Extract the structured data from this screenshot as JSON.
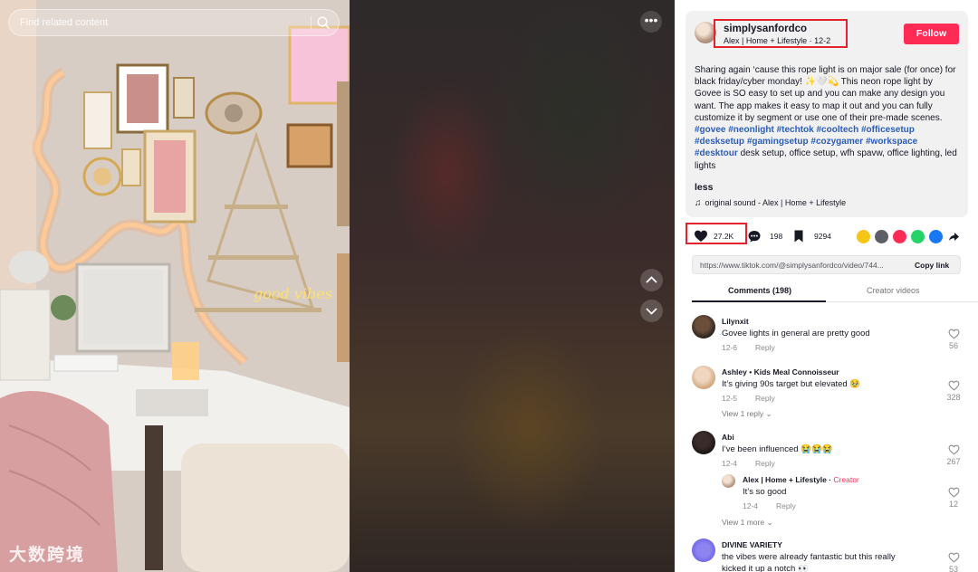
{
  "search": {
    "placeholder": "Find related content"
  },
  "video": {
    "more_label": "•••"
  },
  "watermark": {
    "text": "大数跨境"
  },
  "author": {
    "username": "simplysanfordco",
    "subtitle": "Alex | Home + Lifestyle · 12-2",
    "follow_label": "Follow"
  },
  "description": {
    "text": "Sharing again ‘cause this rope light is on major sale (for once) for black friday/cyber monday! ✨🤍💫 This neon rope light by Govee is SO easy to set up and you can make any design you want. The app makes it easy to map it out and you can fully customize it by segment or use one of their pre-made scenes. ",
    "hashtags": [
      "#govee",
      "#neonlight",
      "#techtok",
      "#cooltech",
      "#officesetup",
      "#desksetup",
      "#gamingsetup",
      "#cozygamer",
      "#workspace",
      "#desktour"
    ],
    "suffix": " desk setup, office setup, wfh spavw, office lighting, led lights",
    "less_label": "less",
    "sound": "original sound - Alex | Home + Lifestyle"
  },
  "stats": {
    "likes": "27.2K",
    "comments": "198",
    "saves": "9294"
  },
  "share": {
    "colors": [
      "#f5c518",
      "#5e5e66",
      "#fe2c55",
      "#25d366",
      "#1877f2"
    ],
    "icons": [
      "embed-icon",
      "code-icon",
      "send-icon",
      "whatsapp-icon",
      "facebook-icon"
    ]
  },
  "link": {
    "url": "https://www.tiktok.com/@simplysanfordco/video/744...",
    "copy_label": "Copy link"
  },
  "tabs": {
    "comments": "Comments (198)",
    "creator_videos": "Creator videos"
  },
  "comments": [
    {
      "name": "Lilynxit",
      "text": "Govee lights in general are pretty good",
      "date": "12-6",
      "reply": "Reply",
      "likes": "56"
    },
    {
      "name": "Ashley • Kids Meal Connoisseur",
      "text": "It’s giving 90s target but elevated 🥹",
      "date": "12-5",
      "reply": "Reply",
      "likes": "328",
      "view_replies": "View 1 reply ⌄"
    },
    {
      "name": "Abi",
      "text": "I’ve been influenced 😭😭😭",
      "date": "12-4",
      "reply": "Reply",
      "likes": "267",
      "view_replies": "View 1 more ⌄",
      "sub": {
        "name": "Alex | Home + Lifestyle",
        "sep": " · ",
        "badge": "Creator",
        "text": "It’s so good",
        "date": "12-4",
        "reply": "Reply",
        "likes": "12"
      }
    },
    {
      "name": "DIVINE VARIETY",
      "text": "the vibes were already fantastic but this really kicked it up a notch 👀",
      "likes": "53"
    }
  ]
}
